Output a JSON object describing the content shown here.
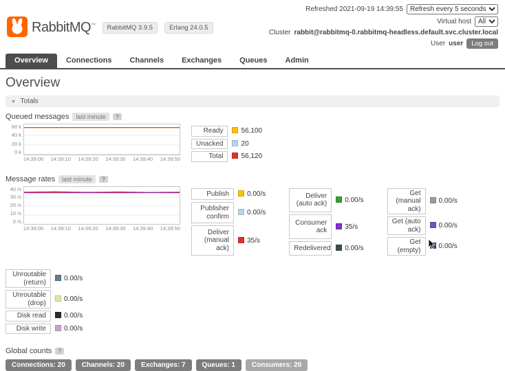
{
  "header": {
    "product_name": "RabbitMQ",
    "tm": "™",
    "badges": [
      "RabbitMQ 3.9.5",
      "Erlang 24.0.5"
    ],
    "refreshed": "Refreshed 2021-09-19 14:39:55",
    "refresh_option": "Refresh every 5 seconds",
    "vhost_label": "Virtual host",
    "vhost_option": "All",
    "cluster_label": "Cluster",
    "cluster_name": "rabbit@rabbitmq-0.rabbitmq-headless.default.svc.cluster.local",
    "user_label": "User",
    "user_name": "user",
    "logout": "Log out",
    "logo_color": "#ff6600"
  },
  "nav": {
    "tabs": [
      "Overview",
      "Connections",
      "Channels",
      "Exchanges",
      "Queues",
      "Admin"
    ]
  },
  "page": {
    "title": "Overview"
  },
  "totals": {
    "arrow": "▼",
    "label": "Totals"
  },
  "sections": {
    "queued": {
      "title": "Queued messages",
      "range_badge": "last minute",
      "help": "?",
      "legend": [
        {
          "label": "Ready",
          "value": "56,100",
          "color": "#ffc000"
        },
        {
          "label": "Unacked",
          "value": "20",
          "color": "#b5d7e8"
        },
        {
          "label": "Total",
          "value": "56,120",
          "color": "#e02f2f"
        }
      ]
    },
    "rates": {
      "title": "Message rates",
      "range_badge": "last minute",
      "help": "?",
      "col1": [
        {
          "label": "Publish",
          "value": "0.00/s",
          "color": "#ffc000"
        },
        {
          "label": "Publisher confirm",
          "value": "0.00/s",
          "color": "#b5d7e8"
        },
        {
          "label": "Deliver (manual ack)",
          "value": "35/s",
          "color": "#e02f2f"
        }
      ],
      "col2": [
        {
          "label": "Deliver (auto ack)",
          "value": "0.00/s",
          "color": "#33a02c"
        },
        {
          "label": "Consumer ack",
          "value": "35/s",
          "color": "#8033d1"
        },
        {
          "label": "Redelivered",
          "value": "0.00/s",
          "color": "#3f4f3f"
        }
      ],
      "col3": [
        {
          "label": "Get (manual ack)",
          "value": "0.00/s",
          "color": "#9b9b9b"
        },
        {
          "label": "Get (auto ack)",
          "value": "0.00/s",
          "color": "#6657c9"
        },
        {
          "label": "Get (empty)",
          "value": "0.00/s",
          "color": "#5a3b6e"
        }
      ],
      "extra": [
        {
          "label": "Unroutable (return)",
          "value": "0.00/s",
          "color": "#5e7f8f"
        },
        {
          "label": "Unroutable (drop)",
          "value": "0.00/s",
          "color": "#dde6a8"
        },
        {
          "label": "Disk read",
          "value": "0.00/s",
          "color": "#2b2b2b"
        },
        {
          "label": "Disk write",
          "value": "0.00/s",
          "color": "#c9a3d0"
        }
      ]
    },
    "global": {
      "title": "Global counts",
      "help": "?",
      "badges": [
        {
          "text": "Connections: 20",
          "color": "#7d7d7d"
        },
        {
          "text": "Channels: 20",
          "color": "#7d7d7d"
        },
        {
          "text": "Exchanges: 7",
          "color": "#7d7d7d"
        },
        {
          "text": "Queues: 1",
          "color": "#7d7d7d"
        },
        {
          "text": "Consumers: 20",
          "color": "#a8a8a8"
        }
      ]
    }
  },
  "chart_data": [
    {
      "type": "line",
      "title": "Queued messages (last minute)",
      "x": [
        "14:39:00",
        "14:39:10",
        "14:39:20",
        "14:39:30",
        "14:39:40",
        "14:39:50"
      ],
      "ylim": [
        0,
        60000
      ],
      "yticks": [
        {
          "v": 60000,
          "label": "60 k"
        },
        {
          "v": 40000,
          "label": "40 k"
        },
        {
          "v": 20000,
          "label": "20 k"
        },
        {
          "v": 0,
          "label": "0 k"
        }
      ],
      "series": [
        {
          "name": "Ready",
          "color": "#ffc000",
          "values": [
            56100,
            56100,
            56100,
            56100,
            56100,
            56100
          ]
        },
        {
          "name": "Unacked",
          "color": "#b5d7e8",
          "values": [
            20,
            20,
            20,
            20,
            20,
            20
          ]
        },
        {
          "name": "Total",
          "color": "#e02f2f",
          "values": [
            56120,
            56120,
            56120,
            56120,
            56120,
            56120
          ]
        }
      ]
    },
    {
      "type": "line",
      "title": "Message rates (last minute)",
      "x": [
        "14:39:00",
        "14:39:10",
        "14:39:20",
        "14:39:30",
        "14:39:40",
        "14:39:50"
      ],
      "ylim": [
        0,
        40
      ],
      "yticks": [
        {
          "v": 40,
          "label": "40 /s"
        },
        {
          "v": 30,
          "label": "30 /s"
        },
        {
          "v": 20,
          "label": "20 /s"
        },
        {
          "v": 10,
          "label": "10 /s"
        },
        {
          "v": 0,
          "label": "0 /s"
        }
      ],
      "series": [
        {
          "name": "Deliver (manual ack)",
          "color": "#e02f2f",
          "values": [
            35,
            35,
            35,
            35,
            35,
            35
          ]
        },
        {
          "name": "Consumer ack",
          "color": "#8033d1",
          "values": [
            35.6,
            36.1,
            35.4,
            35.9,
            35.3,
            35.7
          ]
        }
      ]
    }
  ]
}
